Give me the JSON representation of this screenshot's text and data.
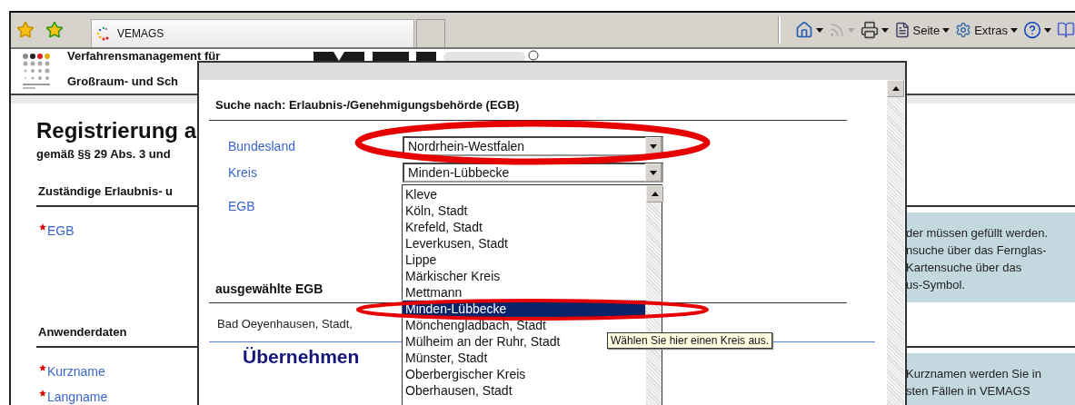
{
  "browser": {
    "tab_title": "VEMAGS",
    "toolbar": [
      {
        "kind": "home",
        "disabled": false
      },
      {
        "kind": "feed",
        "disabled": true
      },
      {
        "kind": "print",
        "disabled": false
      },
      {
        "kind": "page",
        "label": "Seite",
        "disabled": false
      },
      {
        "kind": "gear",
        "label": "Extras",
        "disabled": false
      },
      {
        "kind": "help",
        "disabled": false
      },
      {
        "kind": "research",
        "disabled": false
      }
    ]
  },
  "header": {
    "title_lines": [
      "Verfahrensmanagement für",
      "Großraum- und Sch"
    ]
  },
  "page": {
    "title": "Registrierung a",
    "subtitle": "gemäß §§ 29 Abs. 3 und",
    "sections": [
      {
        "heading": "Zuständige Erlaubnis- u",
        "fields": [
          {
            "label": "EGB",
            "required": true
          }
        ],
        "hint_lines": [
          "der müssen gefüllt werden.",
          "nsuche über das Fernglas-",
          "Kartensuche über das",
          "us-Symbol."
        ]
      },
      {
        "heading": "Anwenderdaten",
        "fields": [
          {
            "label": "Kurzname",
            "required": true
          },
          {
            "label": "Langname",
            "required": true
          }
        ],
        "hint_lines": [
          "Kurznamen werden Sie in",
          "sten Fällen in VEMAGS"
        ]
      }
    ]
  },
  "dialog": {
    "heading": "Suche nach: Erlaubnis-/Genehmigungsbehörde (EGB)",
    "fields": [
      {
        "label": "Bundesland",
        "value": "Nordrhein-Westfalen"
      },
      {
        "label": "Kreis",
        "value": "Minden-Lübbecke"
      },
      {
        "label": "EGB"
      }
    ],
    "kreis_options": [
      {
        "label": "Kleve",
        "selected": false
      },
      {
        "label": "Köln, Stadt",
        "selected": false
      },
      {
        "label": "Krefeld, Stadt",
        "selected": false
      },
      {
        "label": "Leverkusen, Stadt",
        "selected": false
      },
      {
        "label": "Lippe",
        "selected": false
      },
      {
        "label": "Märkischer Kreis",
        "selected": false
      },
      {
        "label": "Mettmann",
        "selected": false
      },
      {
        "label": "Minden-Lübbecke",
        "selected": true
      },
      {
        "label": "Mönchengladbach, Stadt",
        "selected": false
      },
      {
        "label": "Mülheim an der Ruhr, Stadt",
        "selected": false
      },
      {
        "label": "Münster, Stadt",
        "selected": false
      },
      {
        "label": "Oberbergischer Kreis",
        "selected": false
      },
      {
        "label": "Oberhausen, Stadt",
        "selected": false
      }
    ],
    "selected_heading": "ausgewählte EGB",
    "selected_value": "Bad Oeyenhausen, Stadt,",
    "submit": "Übernehmen",
    "tooltip": "Wählen Sie hier einen Kreis aus."
  }
}
